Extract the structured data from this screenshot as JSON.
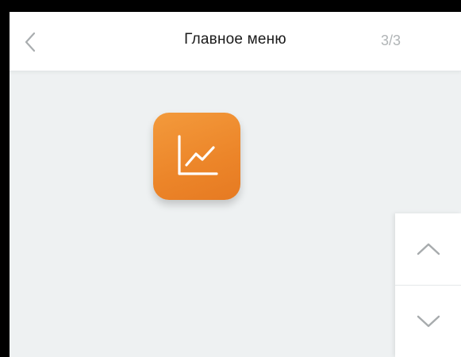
{
  "header": {
    "title": "Главное меню",
    "page_indicator": "3/3",
    "back_icon": "chevron-left-icon"
  },
  "apps": [
    {
      "icon": "line-chart-icon",
      "color": "#ef8a2e"
    }
  ],
  "scroll": {
    "up_icon": "chevron-up-icon",
    "down_icon": "chevron-down-icon"
  },
  "colors": {
    "background": "#eef1f2",
    "header": "#ffffff",
    "accent": "#ef8a2e",
    "muted": "#b0b4b6"
  }
}
